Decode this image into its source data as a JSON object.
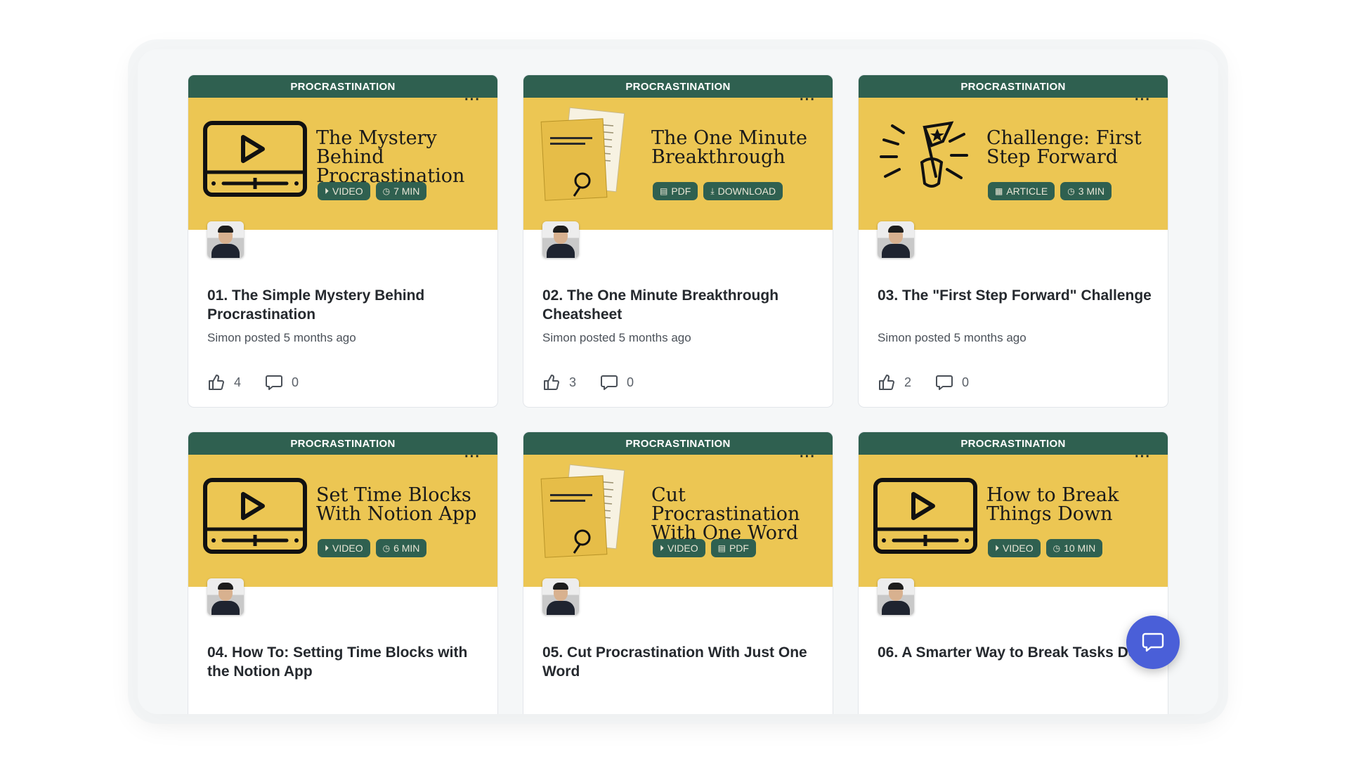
{
  "cards": [
    {
      "category": "PROCRASTINATION",
      "graphic": "video-icon",
      "banner_title": "The Mystery Behind Procrastination",
      "tags": [
        {
          "icon": "play-circle-icon",
          "label": "VIDEO"
        },
        {
          "icon": "clock-icon",
          "label": "7 MIN"
        }
      ],
      "title": "01. The Simple Mystery Behind Procrastination",
      "meta": "Simon posted 5 months ago",
      "likes": "4",
      "comments": "0"
    },
    {
      "category": "PROCRASTINATION",
      "graphic": "document-icon",
      "banner_title": "The One Minute Breakthrough",
      "tags": [
        {
          "icon": "pdf-file-icon",
          "label": "PDF"
        },
        {
          "icon": "download-icon",
          "label": "DOWNLOAD"
        }
      ],
      "title": "02. The One Minute Breakthrough Cheatsheet",
      "meta": "Simon posted 5 months ago",
      "likes": "3",
      "comments": "0"
    },
    {
      "category": "PROCRASTINATION",
      "graphic": "flag-icon",
      "banner_title": "Challenge: First Step Forward",
      "tags": [
        {
          "icon": "article-icon",
          "label": "ARTICLE"
        },
        {
          "icon": "clock-icon",
          "label": "3 MIN"
        }
      ],
      "title": "03. The \"First Step Forward\" Challenge",
      "meta": "Simon posted 5 months ago",
      "likes": "2",
      "comments": "0"
    },
    {
      "category": "PROCRASTINATION",
      "graphic": "video-icon",
      "banner_title": "Set Time Blocks With Notion App",
      "tags": [
        {
          "icon": "play-circle-icon",
          "label": "VIDEO"
        },
        {
          "icon": "clock-icon",
          "label": "6 MIN"
        }
      ],
      "title": "04. How To: Setting Time Blocks with the Notion App",
      "meta": "",
      "likes": "",
      "comments": ""
    },
    {
      "category": "PROCRASTINATION",
      "graphic": "document-icon",
      "banner_title": "Cut Procrastination With One Word",
      "tags": [
        {
          "icon": "play-circle-icon",
          "label": "VIDEO"
        },
        {
          "icon": "pdf-file-icon",
          "label": "PDF"
        }
      ],
      "title": "05. Cut Procrastination With Just One Word",
      "meta": "",
      "likes": "",
      "comments": ""
    },
    {
      "category": "PROCRASTINATION",
      "graphic": "video-icon",
      "banner_title": "How to Break Things Down",
      "tags": [
        {
          "icon": "play-circle-icon",
          "label": "VIDEO"
        },
        {
          "icon": "clock-icon",
          "label": "10 MIN"
        }
      ],
      "title": "06. A Smarter Way to Break Tasks Down",
      "meta": "",
      "likes": "",
      "comments": ""
    }
  ],
  "colors": {
    "ribbon": "#2f6050",
    "banner": "#ecc653",
    "fab": "#4a5fd8"
  },
  "chat_button": {
    "icon": "chat-bubble-icon"
  }
}
